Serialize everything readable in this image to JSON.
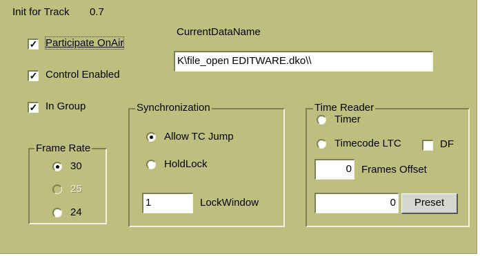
{
  "window": {
    "title_label": "Init for Track",
    "title_value": "0.7"
  },
  "checkboxes": {
    "participate": {
      "label": "Participate OnAir",
      "checked": true
    },
    "control_enabled": {
      "label": "Control Enabled",
      "checked": true
    },
    "in_group": {
      "label": "In Group",
      "checked": true
    }
  },
  "current_data": {
    "label": "CurrentDataName",
    "value": "K\\file_open EDITWARE.dko\\\\"
  },
  "frame_rate": {
    "title": "Frame Rate",
    "options": [
      {
        "label": "30",
        "selected": true,
        "enabled": true
      },
      {
        "label": "25",
        "selected": false,
        "enabled": false
      },
      {
        "label": "24",
        "selected": false,
        "enabled": true
      }
    ]
  },
  "synchronization": {
    "title": "Synchronization",
    "allow_tc_jump": {
      "label": "Allow TC Jump",
      "selected": true
    },
    "holdlock": {
      "label": "HoldLock",
      "selected": false
    },
    "lock_window": {
      "value": "1",
      "label": "LockWindow"
    }
  },
  "time_reader": {
    "title": "Time Reader",
    "timer": {
      "label": "Timer",
      "selected": false
    },
    "timecode_ltc": {
      "label": "Timecode LTC",
      "selected": false
    },
    "df": {
      "label": "DF",
      "checked": false
    },
    "frames_offset": {
      "value": "0",
      "label": "Frames Offset"
    },
    "preset": {
      "value": "0",
      "button_label": "Preset"
    }
  },
  "colors": {
    "panel": "#bebf7f",
    "shadow": "#7f7f54",
    "highlight": "#f4f4de"
  }
}
